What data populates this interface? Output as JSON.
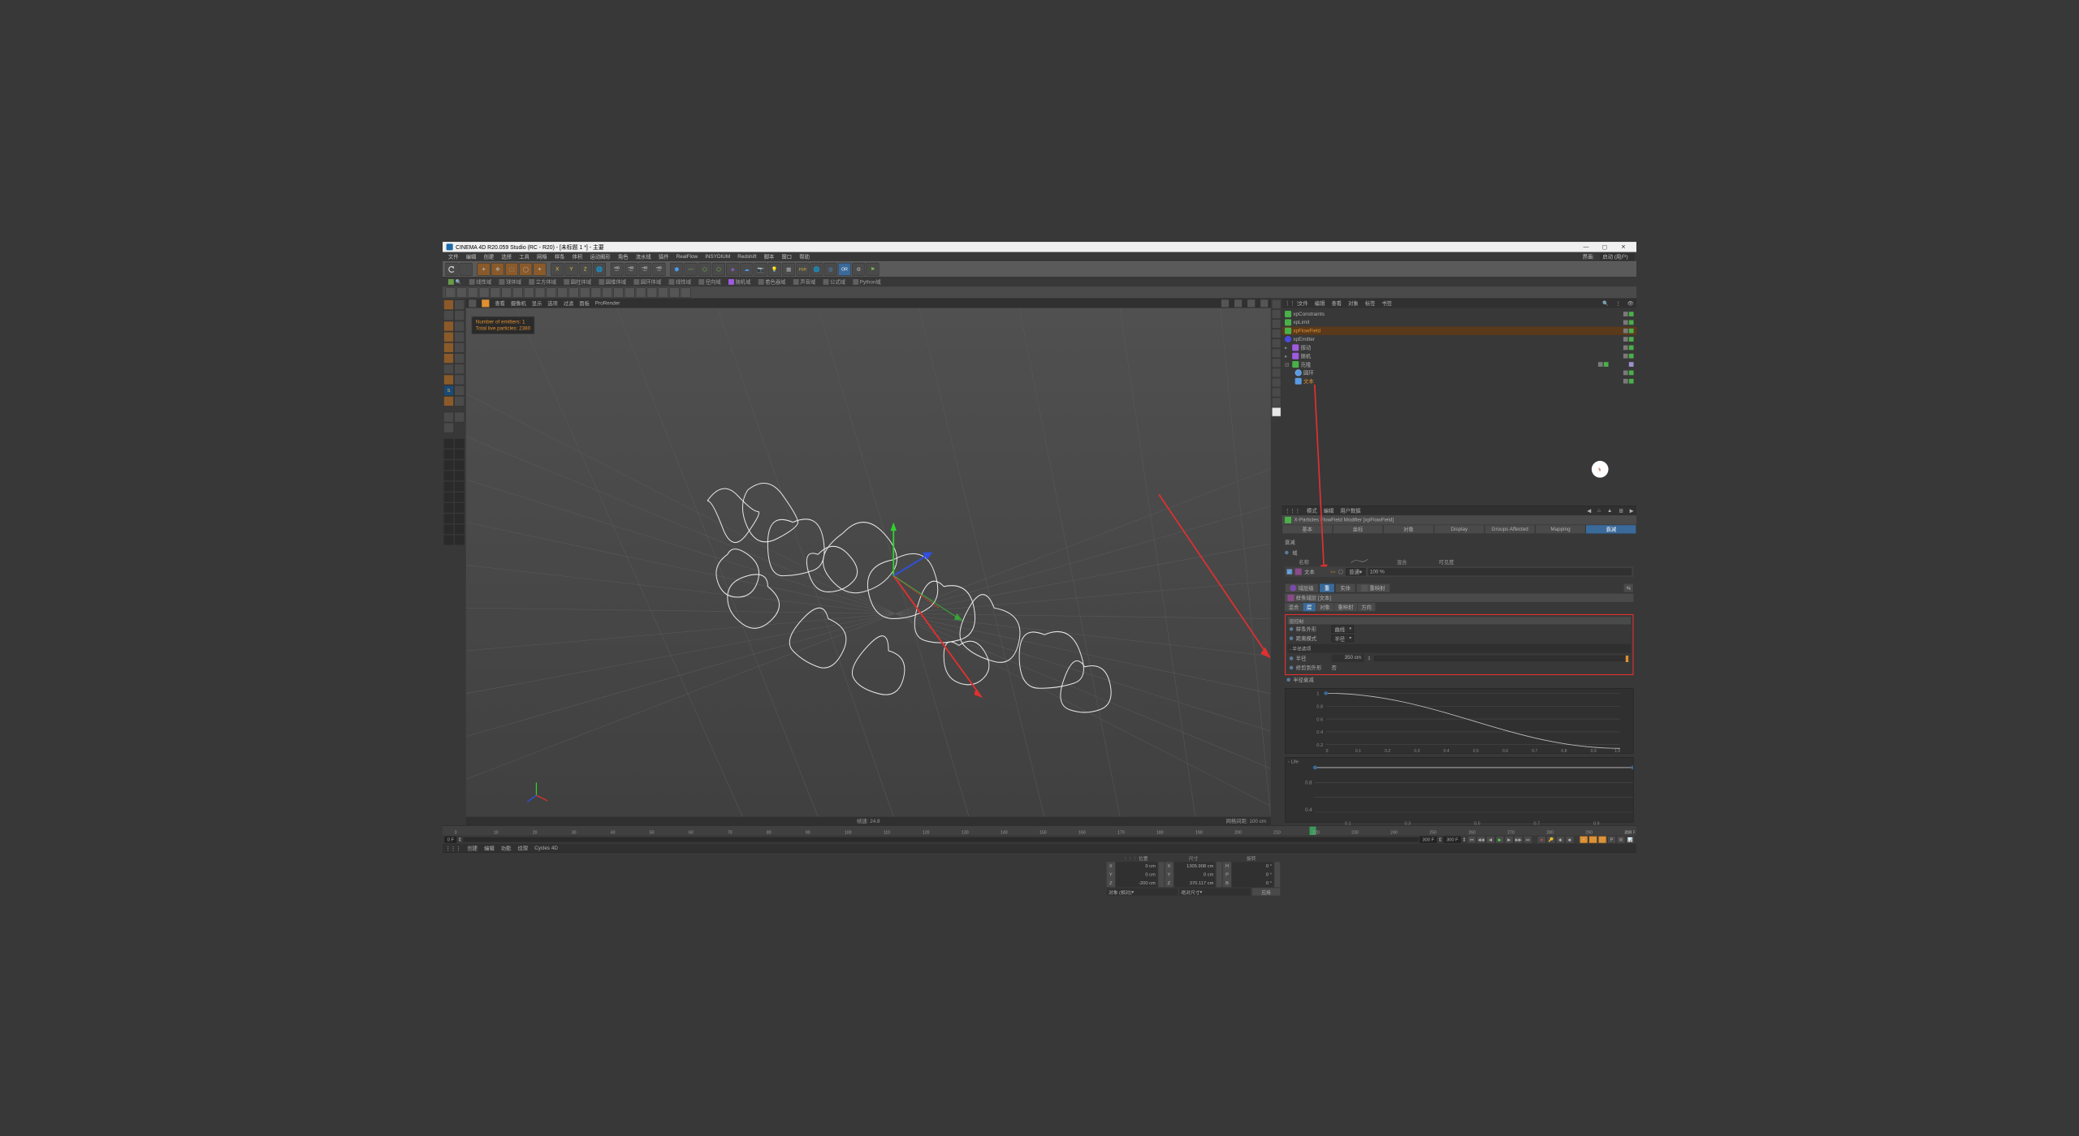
{
  "title": "CINEMA 4D R20.059 Studio (RC - R20) - [未标题 1 *] - 主要",
  "menu": [
    "文件",
    "编辑",
    "创建",
    "选择",
    "工具",
    "网格",
    "样条",
    "体积",
    "运动图形",
    "角色",
    "流水线",
    "插件",
    "RealFlow",
    "INSYDIUM",
    "Redshift",
    "脚本",
    "窗口",
    "帮助"
  ],
  "menu_right_label": "界面:",
  "menu_right_value": "启动 (用户)",
  "fields_bar": [
    "线性域",
    "球体域",
    "立方体域",
    "圆柱体域",
    "圆锥体域",
    "圆环体域",
    "线性域",
    "径向域",
    "随机域",
    "着色器域",
    "声音域",
    "公式域",
    "Python域"
  ],
  "viewport_menu": [
    "查看",
    "摄像机",
    "显示",
    "选项",
    "过滤",
    "面板",
    "ProRender"
  ],
  "hud": {
    "emitters": "Number of emitters: 1",
    "particles": "Total live particles: 2380"
  },
  "vp_status": {
    "fps": "帧速: 24.8",
    "grid": "网格间距: 100 cm"
  },
  "obj_menu": [
    "文件",
    "编辑",
    "查看",
    "对象",
    "标签",
    "书签"
  ],
  "objects": [
    {
      "name": "xpConstraints",
      "indent": 0,
      "color": "#4ab04a"
    },
    {
      "name": "xpLimit",
      "indent": 0,
      "color": "#4ab04a"
    },
    {
      "name": "xpFlowField",
      "indent": 0,
      "color": "#4ab04a",
      "sel": true
    },
    {
      "name": "xpEmitter",
      "indent": 0,
      "color": "#4a4ae0"
    },
    {
      "name": "振动",
      "indent": 0,
      "color": "#a05ae0"
    },
    {
      "name": "随机",
      "indent": 0,
      "color": "#a05ae0"
    },
    {
      "name": "克隆",
      "indent": 0,
      "color": "#4ab04a",
      "exp": true
    },
    {
      "name": "圆环",
      "indent": 1,
      "color": "#5a9ae0"
    },
    {
      "name": "文本",
      "indent": 1,
      "color": "#e09030",
      "orange": true
    }
  ],
  "attr_menu": [
    "模式",
    "编辑",
    "用户数据"
  ],
  "attr_title": "X-Particles FlowField Modifier [xpFlowField]",
  "attr_tabs": [
    "基本",
    "坐标",
    "对象",
    "Display",
    "Groups Affected",
    "Mapping",
    "衰减"
  ],
  "attr_tabs_active": 6,
  "falloff": {
    "section": "衰减",
    "domain_label": "域",
    "headers": [
      "名称",
      "混合",
      "可见度"
    ],
    "field_name": "文本",
    "blend_mode": "普通",
    "pct": "100 %"
  },
  "subtabs": [
    "域层级",
    "重",
    "实体",
    "重映射"
  ],
  "spline_title": "样条域层 [文本]",
  "spline_tabs": [
    "混合",
    "层",
    "对象",
    "重映射",
    "方向"
  ],
  "spline_tabs_active": 1,
  "redbox_header": "层控制",
  "params": {
    "shape_label": "样条外形",
    "shape_val": "曲线",
    "dist_label": "距离模式",
    "dist_val": "半径",
    "radius_section": "- 半径选项",
    "radius_label": "半径",
    "radius_val": "350 cm",
    "clip_label": "修剪到外形",
    "clip_val": "否",
    "rfall_label": "半径衰减"
  },
  "graph_ticks_y": [
    "1",
    "0.8",
    "0.6",
    "0.4",
    "0.2"
  ],
  "graph_ticks_x": [
    "0",
    "0.1",
    "0.2",
    "0.3",
    "0.4",
    "0.5",
    "0.6",
    "0.7",
    "0.8",
    "0.9",
    "1.0"
  ],
  "life_label": "Life",
  "timeline": {
    "start": 0,
    "end": 300,
    "current": 218,
    "frame_label": "218 F",
    "range_start": "0 F",
    "range_end": "300 F",
    "fval2": "300 F"
  },
  "bottom_menu": [
    "创建",
    "编辑",
    "功能",
    "纹理",
    "Cycles 4D"
  ],
  "coord": {
    "headers": [
      "位置",
      "尺寸",
      "旋转"
    ],
    "rows": [
      {
        "axis": "X",
        "pos": "0 cm",
        "size_l": "X",
        "size": "1305.908 cm",
        "rot_l": "H",
        "rot": "0 °"
      },
      {
        "axis": "Y",
        "pos": "0 cm",
        "size_l": "Y",
        "size": "0 cm",
        "rot_l": "P",
        "rot": "0 °"
      },
      {
        "axis": "Z",
        "pos": "-200 cm",
        "size_l": "Z",
        "size": "370.117 cm",
        "rot_l": "B",
        "rot": "0 °"
      }
    ],
    "dd1": "对象 (相对)",
    "dd2": "绝对尺寸",
    "btn": "应用"
  }
}
